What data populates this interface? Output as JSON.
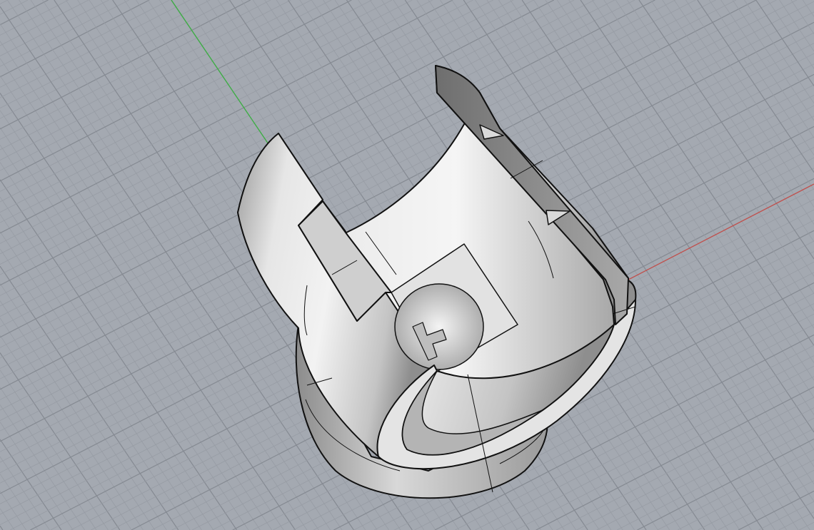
{
  "viewport": {
    "view": "perspective",
    "background_color": "#a4a9b1",
    "grid_minor_color": "#979ca4",
    "grid_major_color": "#858a92",
    "x_axis_color": "#c0504d",
    "y_axis_color": "#3cb043",
    "model_edge_color": "#111111",
    "model_surface_color": "#d8d8d8"
  }
}
